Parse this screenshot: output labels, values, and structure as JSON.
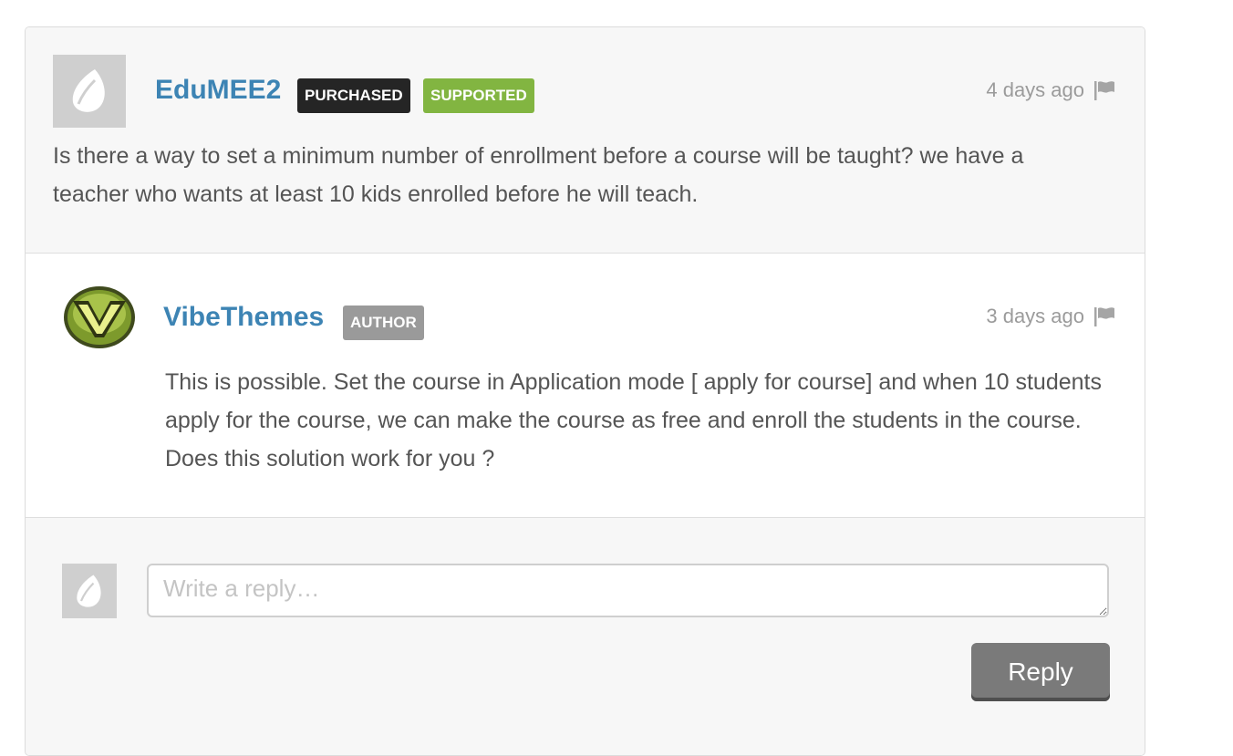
{
  "comment": {
    "username": "EduMEE2",
    "badges": [
      "PURCHASED",
      "SUPPORTED"
    ],
    "time": "4 days ago",
    "text": "Is there a way to set a minimum number of enrollment before a course will be taught? we have a teacher who wants at least 10 kids enrolled before he will teach."
  },
  "reply": {
    "username": "VibeThemes",
    "badge": "AUTHOR",
    "time": "3 days ago",
    "text": "This is possible. Set the course in Application mode [ apply for course] and when 10 students apply for the course, we can make the course as free and enroll the students in the course. Does this solution work for you ?"
  },
  "reply_form": {
    "placeholder": "Write a reply…",
    "button_label": "Reply"
  },
  "icons": {
    "flag": "flag-icon",
    "default_avatar": "envato-leaf-avatar",
    "author_avatar": "vibethemes-v-logo"
  },
  "colors": {
    "username": "#3d84b4",
    "purchased_badge": "#252525",
    "supported_badge": "#82b541",
    "author_badge": "#9a9a9a",
    "reply_button": "#7a7a7a"
  }
}
